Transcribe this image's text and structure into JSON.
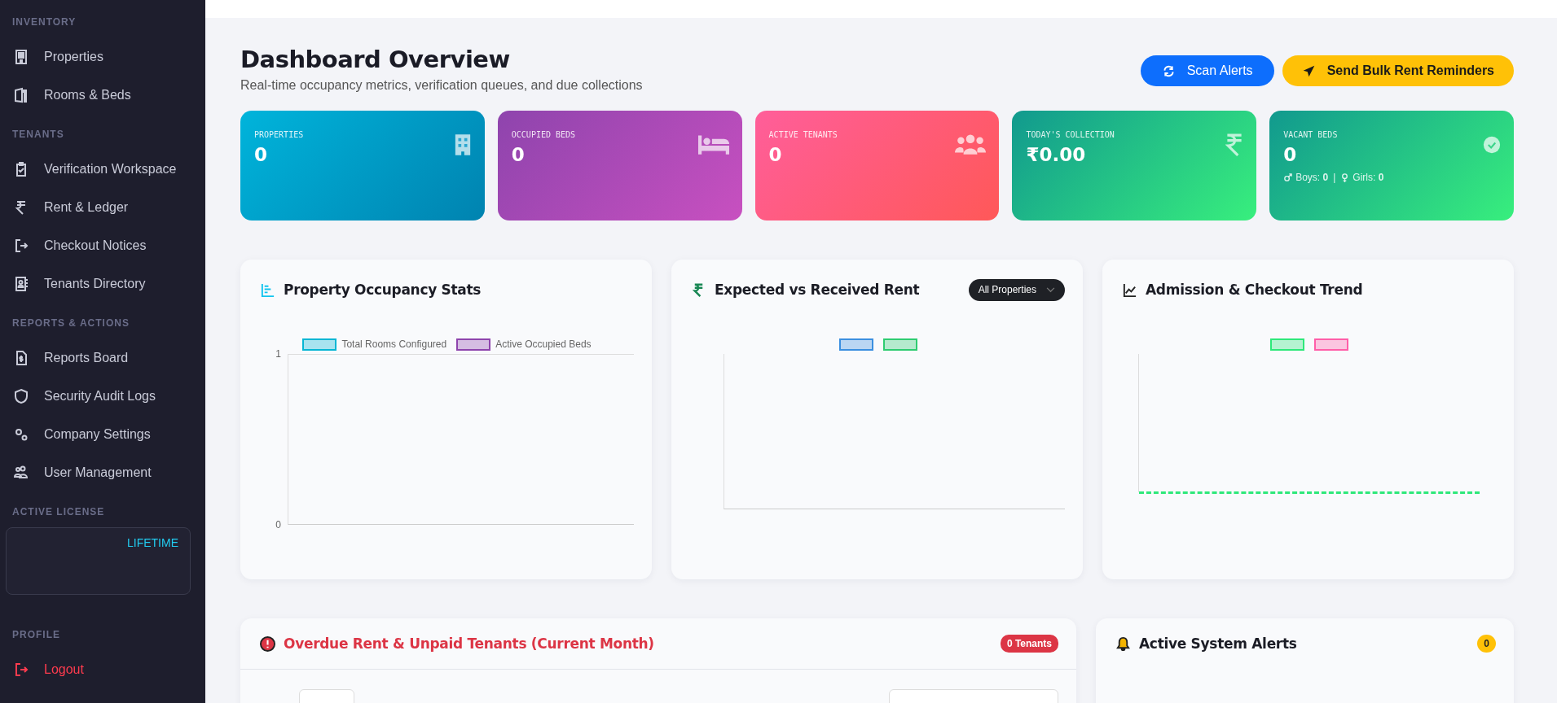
{
  "sidebar": {
    "sections": [
      {
        "title": "INVENTORY",
        "items": [
          {
            "label": "Properties",
            "kind": "building"
          },
          {
            "label": "Rooms & Beds",
            "kind": "door"
          }
        ]
      },
      {
        "title": "TENANTS",
        "items": [
          {
            "label": "Verification Workspace",
            "kind": "clipboard"
          },
          {
            "label": "Rent & Ledger",
            "kind": "rupee"
          },
          {
            "label": "Checkout Notices",
            "kind": "exit"
          },
          {
            "label": "Tenants Directory",
            "kind": "contact"
          }
        ]
      },
      {
        "title": "REPORTS & ACTIONS",
        "items": [
          {
            "label": "Reports Board",
            "kind": "report"
          },
          {
            "label": "Security Audit Logs",
            "kind": "shield"
          },
          {
            "label": "Company Settings",
            "kind": "gears"
          },
          {
            "label": "User Management",
            "kind": "users"
          }
        ]
      }
    ],
    "license": {
      "title": "ACTIVE LICENSE",
      "plan": "LIFETIME"
    },
    "profile": {
      "title": "PROFILE",
      "items": [
        {
          "label": "Logout",
          "kind": "logout"
        }
      ]
    }
  },
  "header": {
    "title": "Dashboard Overview",
    "subtitle": "Real-time occupancy metrics, verification queues, and due collections",
    "actions": [
      {
        "label": "Scan Alerts",
        "kind": "primary"
      },
      {
        "label": "Send Bulk Rent Reminders",
        "kind": "warning"
      }
    ]
  },
  "stats": [
    {
      "label": "PROPERTIES",
      "value": "0",
      "kind": "properties"
    },
    {
      "label": "OCCUPIED BEDS",
      "value": "0",
      "kind": "beds"
    },
    {
      "label": "ACTIVE TENANTS",
      "value": "0",
      "kind": "tenants"
    },
    {
      "label": "TODAY'S COLLECTION",
      "value": "₹0.00",
      "kind": "collection"
    },
    {
      "label": "VACANT BEDS",
      "value": "0",
      "kind": "vacant",
      "separator": "|",
      "breakdown": [
        {
          "kind": "male",
          "label": "Boys:",
          "value": "0"
        },
        {
          "kind": "female",
          "label": "Girls:",
          "value": "0"
        }
      ]
    }
  ],
  "charts": [
    {
      "kind": "bars",
      "title": "Property Occupancy Stats",
      "legend": [
        {
          "label": "Total Rooms Configured",
          "color": "#06b6d4"
        },
        {
          "label": "Active Occupied Beds",
          "color": "#8e44ad"
        }
      ],
      "yticks": [
        "1",
        "0"
      ]
    },
    {
      "kind": "bars",
      "title": "Expected vs Received Rent",
      "filter": "All Properties",
      "legend": [
        {
          "color": "#3b8fe0"
        },
        {
          "color": "#2ecc71"
        }
      ]
    },
    {
      "kind": "line",
      "title": "Admission & Checkout Trend",
      "legend": [
        {
          "color": "#2ee87a"
        },
        {
          "color": "#ff5ea8"
        }
      ]
    }
  ],
  "overdue": {
    "title": "Overdue Rent & Unpaid Tenants (Current Month)",
    "badge": "0 Tenants"
  },
  "alerts": {
    "title": "Active System Alerts",
    "badge": "0"
  }
}
